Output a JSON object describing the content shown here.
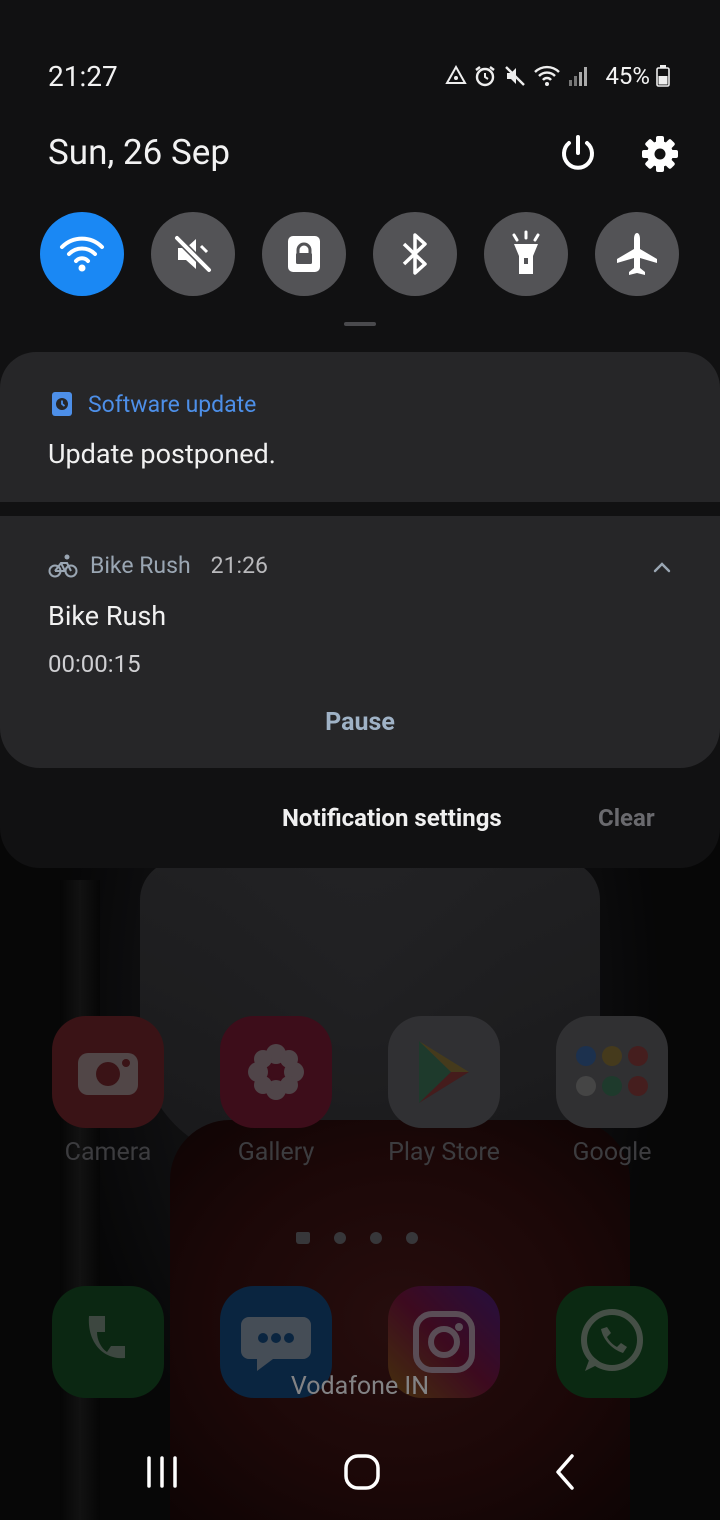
{
  "status_bar": {
    "time": "21:27",
    "battery": "45%"
  },
  "shade": {
    "date": "Sun, 26 Sep",
    "quick_settings": [
      {
        "name": "wifi-icon",
        "active": true
      },
      {
        "name": "mute-icon",
        "active": false
      },
      {
        "name": "lock-icon",
        "active": false
      },
      {
        "name": "bluetooth-icon",
        "active": false
      },
      {
        "name": "flashlight-icon",
        "active": false
      },
      {
        "name": "airplane-icon",
        "active": false
      }
    ]
  },
  "notifications": {
    "software_update": {
      "app_name": "Software update",
      "text": "Update postponed."
    },
    "bike_rush": {
      "app_name": "Bike Rush",
      "time": "21:26",
      "title": "Bike Rush",
      "timer": "00:00:15",
      "action": "Pause"
    }
  },
  "footer": {
    "settings_label": "Notification settings",
    "clear_label": "Clear"
  },
  "home": {
    "apps_row1": [
      {
        "label": "Camera"
      },
      {
        "label": "Gallery"
      },
      {
        "label": "Play Store"
      },
      {
        "label": "Google"
      }
    ],
    "carrier": "Vodafone IN"
  },
  "colors": {
    "accent": "#1a88f4",
    "shade_bg": "#111112",
    "card_bg": "#262628"
  }
}
